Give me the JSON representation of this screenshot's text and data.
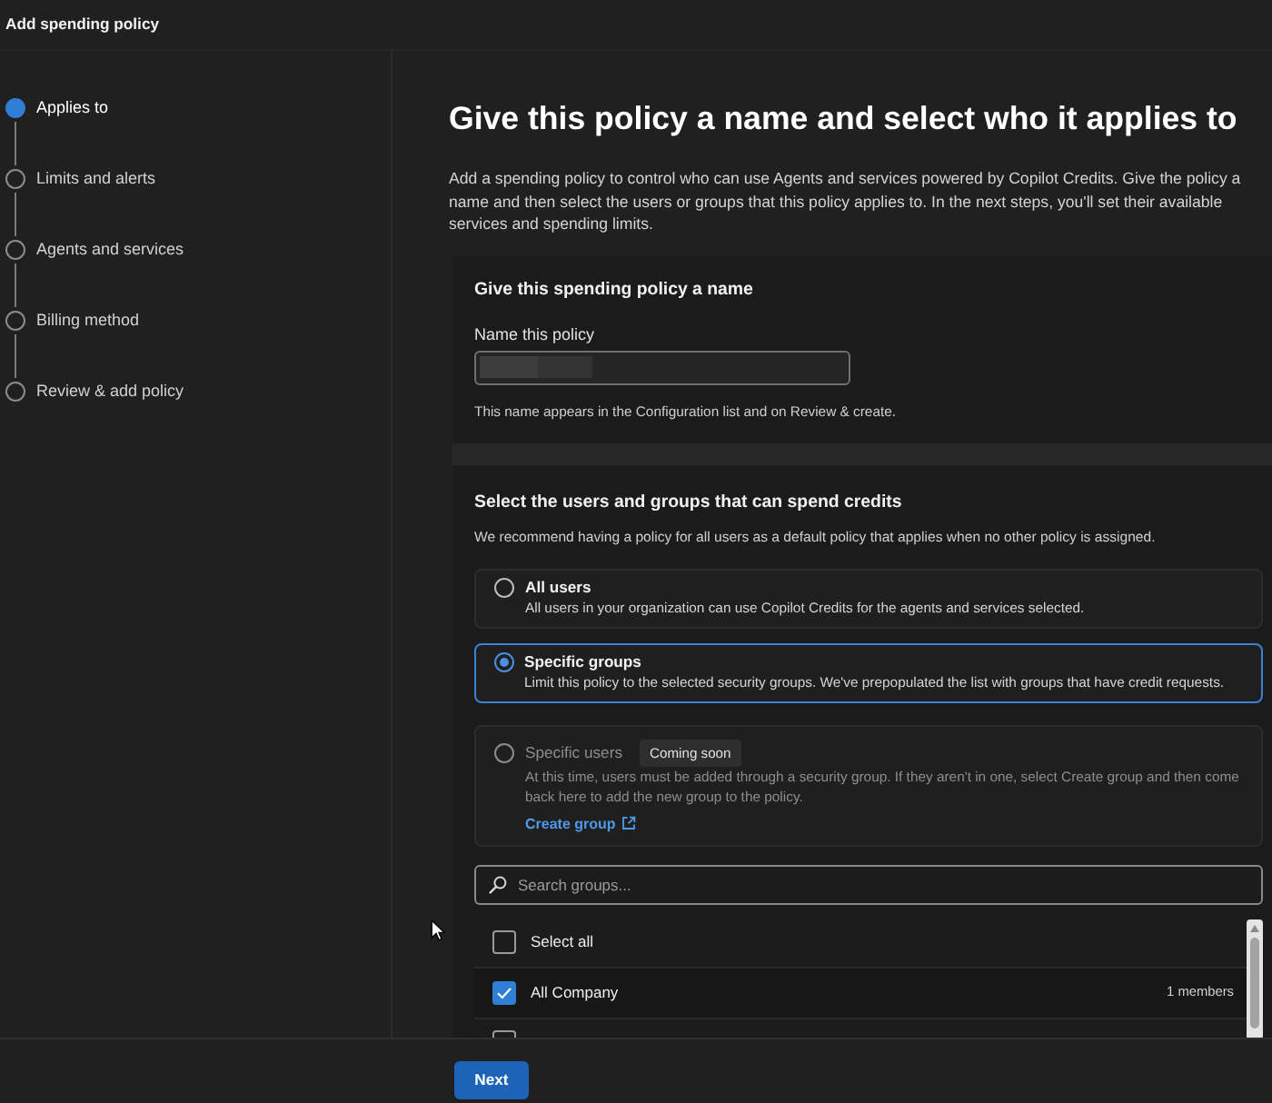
{
  "window": {
    "title": "Add spending policy"
  },
  "steps": [
    {
      "label": "Applies to",
      "selected": true
    },
    {
      "label": "Limits and alerts",
      "selected": false
    },
    {
      "label": "Agents and services",
      "selected": false
    },
    {
      "label": "Billing method",
      "selected": false
    },
    {
      "label": "Review & add policy",
      "selected": false
    }
  ],
  "page": {
    "title": "Give this policy a name and select who it applies to",
    "description": "Add a spending policy to control who can use Agents and services powered by Copilot Credits. Give the policy a name and then select the users or groups that this policy applies to. In the next steps, you'll set their available services and spending limits."
  },
  "name_section": {
    "heading": "Give this spending policy a name",
    "field_label": "Name this policy",
    "value_hidden": true,
    "hint": "This name appears in the Configuration list and on Review & create."
  },
  "audience_section": {
    "heading": "Select the users and groups that can spend credits",
    "description": "We recommend having a policy for all users as a default policy that applies when no other policy is assigned.",
    "options": [
      {
        "title": "All users",
        "description": "All users in your organization can use Copilot Credits for the agents and services selected.",
        "selected": false,
        "disabled": false
      },
      {
        "title": "Specific groups",
        "description": "Limit this policy to the selected security groups. We've prepopulated the list with groups that have credit requests.",
        "selected": true,
        "disabled": false
      },
      {
        "title": "Specific users",
        "badge": "Coming soon",
        "description": "At this time, users must be added through a security group. If they aren't in one, select Create group and then come back here to add the new group to the policy.",
        "link": "Create group",
        "selected": false,
        "disabled": true
      }
    ],
    "search": {
      "placeholder": "Search groups..."
    },
    "select_all": {
      "label": "Select all",
      "checked": false
    },
    "groups": [
      {
        "name": "All Company",
        "members": "1 members",
        "checked": true
      },
      {
        "checked": false
      }
    ]
  },
  "footer": {
    "next_button": "Next"
  }
}
